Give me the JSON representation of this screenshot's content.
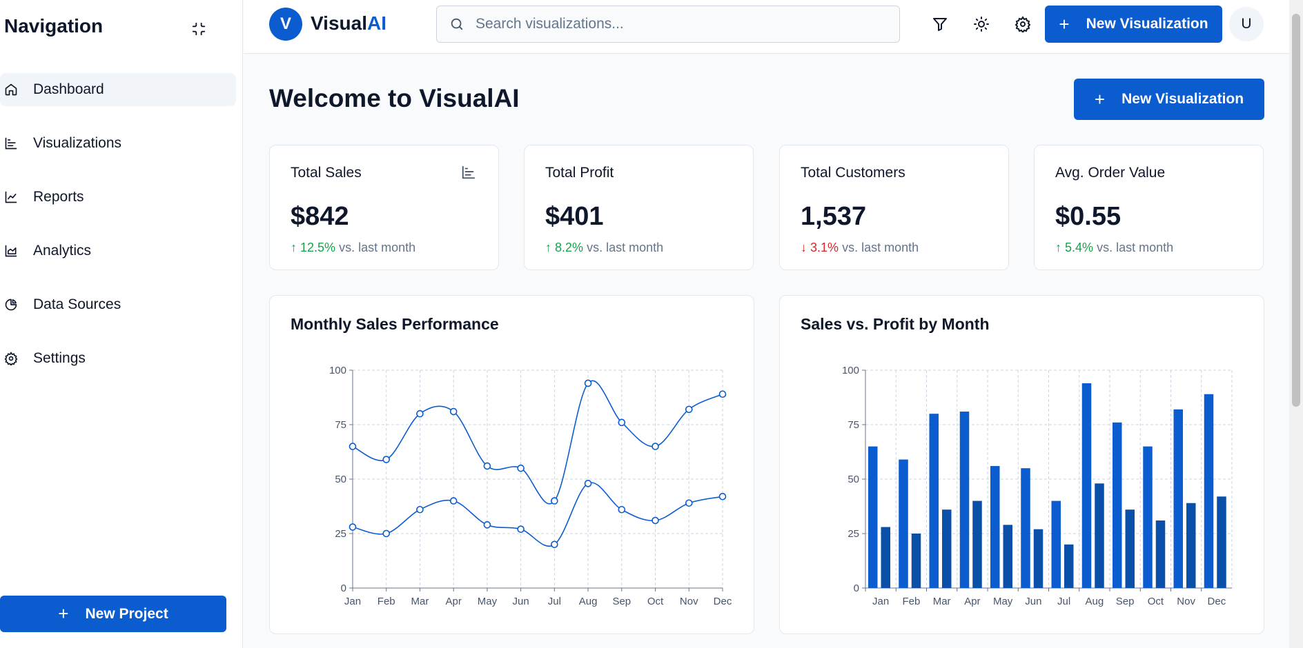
{
  "sidebar": {
    "title": "Navigation",
    "items": [
      {
        "label": "Dashboard",
        "icon": "home-icon",
        "active": true
      },
      {
        "label": "Visualizations",
        "icon": "bar-chart-icon"
      },
      {
        "label": "Reports",
        "icon": "line-chart-icon"
      },
      {
        "label": "Analytics",
        "icon": "area-chart-icon"
      },
      {
        "label": "Data Sources",
        "icon": "pie-chart-icon"
      },
      {
        "label": "Settings",
        "icon": "gear-icon"
      }
    ],
    "new_project_label": "New Project"
  },
  "topbar": {
    "logo_letter": "V",
    "logo_main": "Visual",
    "logo_accent": "AI",
    "search_placeholder": "Search visualizations...",
    "new_viz_label": "New Visualization",
    "user_initial": "U"
  },
  "main": {
    "welcome": "Welcome to VisualAI",
    "new_viz_label": "New Visualization",
    "stats": [
      {
        "title": "Total Sales",
        "value": "$842",
        "change": "12.5%",
        "direction": "up",
        "suffix": "vs. last month"
      },
      {
        "title": "Total Profit",
        "value": "$401",
        "change": "8.2%",
        "direction": "up",
        "suffix": "vs. last month"
      },
      {
        "title": "Total Customers",
        "value": "1,537",
        "change": "3.1%",
        "direction": "down",
        "suffix": "vs. last month"
      },
      {
        "title": "Avg. Order Value",
        "value": "$0.55",
        "change": "5.4%",
        "direction": "up",
        "suffix": "vs. last month"
      }
    ]
  },
  "colors": {
    "accent": "#0b5ccf",
    "dark_series": "#0a4fa8",
    "up": "#16a34a",
    "down": "#dc2626"
  },
  "chart_data": [
    {
      "type": "line",
      "title": "Monthly Sales Performance",
      "categories": [
        "Jan",
        "Feb",
        "Mar",
        "Apr",
        "May",
        "Jun",
        "Jul",
        "Aug",
        "Sep",
        "Oct",
        "Nov",
        "Dec"
      ],
      "series": [
        {
          "values": [
            65,
            59,
            80,
            81,
            56,
            55,
            40,
            94,
            76,
            65,
            82,
            89
          ]
        },
        {
          "values": [
            28,
            25,
            36,
            40,
            29,
            27,
            20,
            48,
            36,
            31,
            39,
            42
          ]
        }
      ],
      "ylim": [
        0,
        100
      ],
      "yticks": [
        0,
        25,
        50,
        75,
        100
      ],
      "grid": true
    },
    {
      "type": "bar",
      "title": "Sales vs. Profit by Month",
      "categories": [
        "Jan",
        "Feb",
        "Mar",
        "Apr",
        "May",
        "Jun",
        "Jul",
        "Aug",
        "Sep",
        "Oct",
        "Nov",
        "Dec"
      ],
      "series": [
        {
          "values": [
            65,
            59,
            80,
            81,
            56,
            55,
            40,
            94,
            76,
            65,
            82,
            89
          ]
        },
        {
          "values": [
            28,
            25,
            36,
            40,
            29,
            27,
            20,
            48,
            36,
            31,
            39,
            42
          ]
        }
      ],
      "ylim": [
        0,
        100
      ],
      "yticks": [
        0,
        25,
        50,
        75,
        100
      ],
      "grid": true
    }
  ]
}
